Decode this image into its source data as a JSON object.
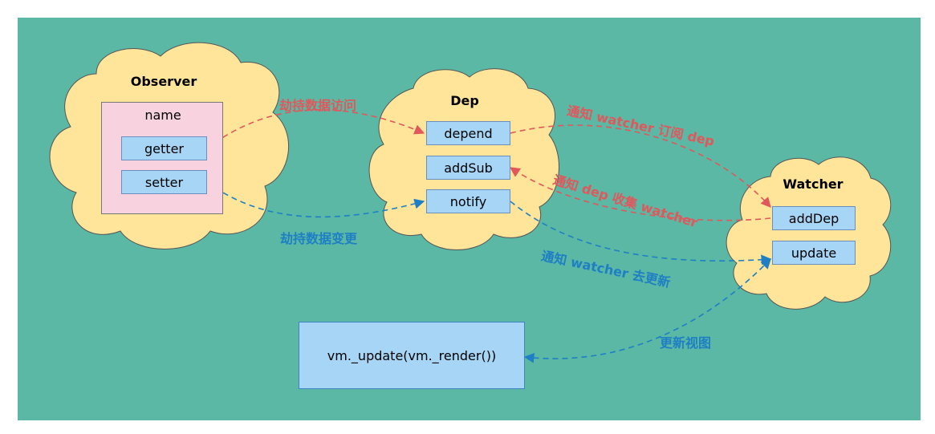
{
  "colors": {
    "canvas": "#5bb8a5",
    "cloud": "#ffe59a",
    "node": "#a6d5f5",
    "name_box": "#f8d3df",
    "red_edge": "#e0585b",
    "blue_edge": "#1f7fc4"
  },
  "observer": {
    "title": "Observer",
    "name_label": "name",
    "getter": "getter",
    "setter": "setter"
  },
  "dep": {
    "title": "Dep",
    "depend": "depend",
    "addSub": "addSub",
    "notify": "notify"
  },
  "watcher": {
    "title": "Watcher",
    "addDep": "addDep",
    "update": "update"
  },
  "render": {
    "label": "vm._update(vm._render())"
  },
  "edges": {
    "hijack_access": "劫持数据访问",
    "hijack_change": "劫持数据变更",
    "notify_subscribe": "通知 watcher 订阅 dep",
    "notify_collect": "通知 dep 收集 watcher",
    "notify_update": "通知 watcher 去更新",
    "update_view": "更新视图"
  }
}
